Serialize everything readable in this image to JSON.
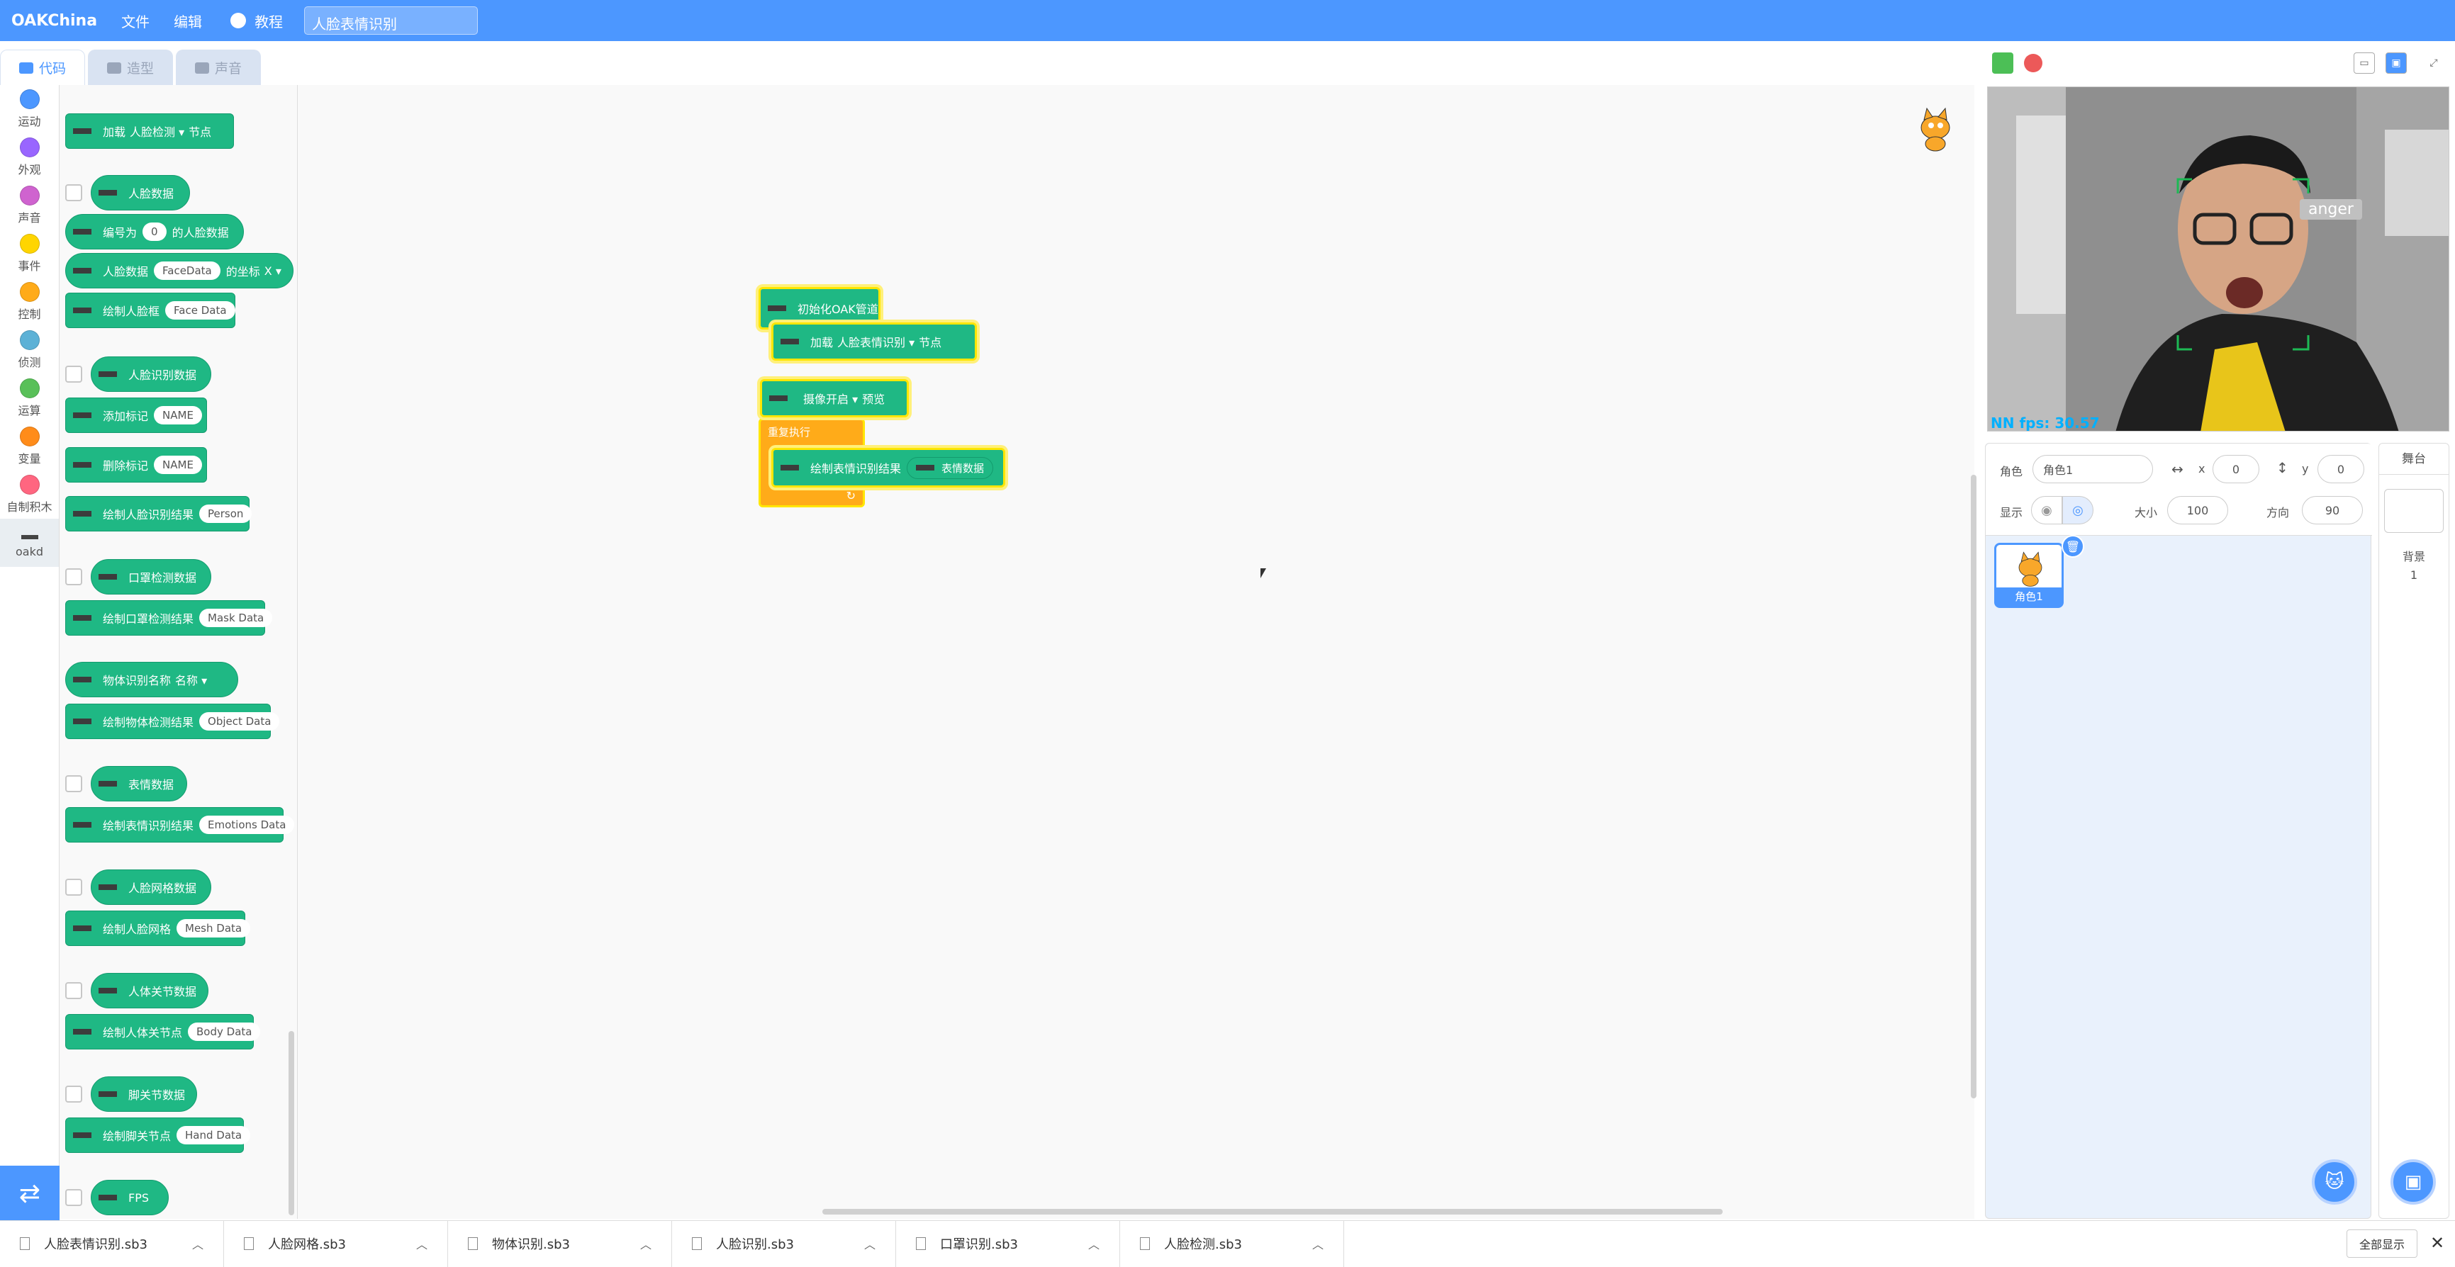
{
  "app": {
    "logo": "OAKChina",
    "menu_file": "文件",
    "menu_edit": "编辑",
    "menu_tutorial": "教程",
    "project_name": "人脸表情识别"
  },
  "tabs": {
    "code": "代码",
    "costumes": "造型",
    "sounds": "声音"
  },
  "categories": [
    {
      "label": "运动",
      "color": "#4c97ff"
    },
    {
      "label": "外观",
      "color": "#9966ff"
    },
    {
      "label": "声音",
      "color": "#cf63cf"
    },
    {
      "label": "事件",
      "color": "#ffd500"
    },
    {
      "label": "控制",
      "color": "#ffab19"
    },
    {
      "label": "侦测",
      "color": "#5cb1d6"
    },
    {
      "label": "运算",
      "color": "#59c059"
    },
    {
      "label": "变量",
      "color": "#ff8c1a"
    },
    {
      "label": "自制积木",
      "color": "#ff6680"
    },
    {
      "label": "oakd",
      "color": "#444444"
    }
  ],
  "palette": {
    "load_node": {
      "a": "加载",
      "dd": "人脸检测",
      "b": "节点"
    },
    "face_data": "人脸数据",
    "face_by_id": {
      "a": "编号为",
      "v": "0",
      "b": "的人脸数据"
    },
    "face_coord": {
      "a": "人脸数据",
      "v": "FaceData",
      "b": "的坐标",
      "dd": "X"
    },
    "draw_face": {
      "a": "绘制人脸框",
      "v": "Face Data"
    },
    "face_recog_data": "人脸识别数据",
    "add_mark": {
      "a": "添加标记",
      "v": "NAME"
    },
    "del_mark": {
      "a": "删除标记",
      "v": "NAME"
    },
    "draw_face_recog": {
      "a": "绘制人脸识别结果",
      "v": "Person"
    },
    "mask_data": "口罩检测数据",
    "draw_mask": {
      "a": "绘制口罩检测结果",
      "v": "Mask Data"
    },
    "object_name": {
      "a": "物体识别名称",
      "dd": "名称"
    },
    "draw_object": {
      "a": "绘制物体检测结果",
      "v": "Object Data"
    },
    "emotion_data": "表情数据",
    "draw_emotion": {
      "a": "绘制表情识别结果",
      "v": "Emotions Data"
    },
    "mesh_data": "人脸网格数据",
    "draw_mesh": {
      "a": "绘制人脸网格",
      "v": "Mesh Data"
    },
    "body_data": "人体关节数据",
    "draw_body": {
      "a": "绘制人体关节点",
      "v": "Body Data"
    },
    "hand_data": "脚关节数据",
    "draw_hand": {
      "a": "绘制脚关节点",
      "v": "Hand Data"
    },
    "fps": "FPS"
  },
  "script": {
    "init": "初始化OAK管道",
    "load": {
      "a": "加载",
      "dd": "人脸表情识别",
      "b": "节点"
    },
    "camera": {
      "dd": "摄像开启",
      "b": "预览"
    },
    "forever": "重复执行",
    "draw": {
      "a": "绘制表情识别结果",
      "v": "表情数据"
    }
  },
  "stage": {
    "overlay": "NN fps: 30.57",
    "emotion_label": "anger"
  },
  "sprite": {
    "label_sprite": "角色",
    "name": "角色1",
    "x_label": "x",
    "x": "0",
    "y_label": "y",
    "y": "0",
    "show_label": "显示",
    "size_label": "大小",
    "size": "100",
    "dir_label": "方向",
    "direction": "90",
    "thumb_name": "角色1"
  },
  "stage_panel": {
    "title": "舞台",
    "backdrops_label": "背景",
    "backdrops_count": "1"
  },
  "files": [
    {
      "name": "人脸表情识别.sb3"
    },
    {
      "name": "人脸网格.sb3"
    },
    {
      "name": "物体识别.sb3"
    },
    {
      "name": "人脸识别.sb3"
    },
    {
      "name": "口罩识别.sb3"
    },
    {
      "name": "人脸检测.sb3"
    }
  ],
  "show_all": "全部显示"
}
